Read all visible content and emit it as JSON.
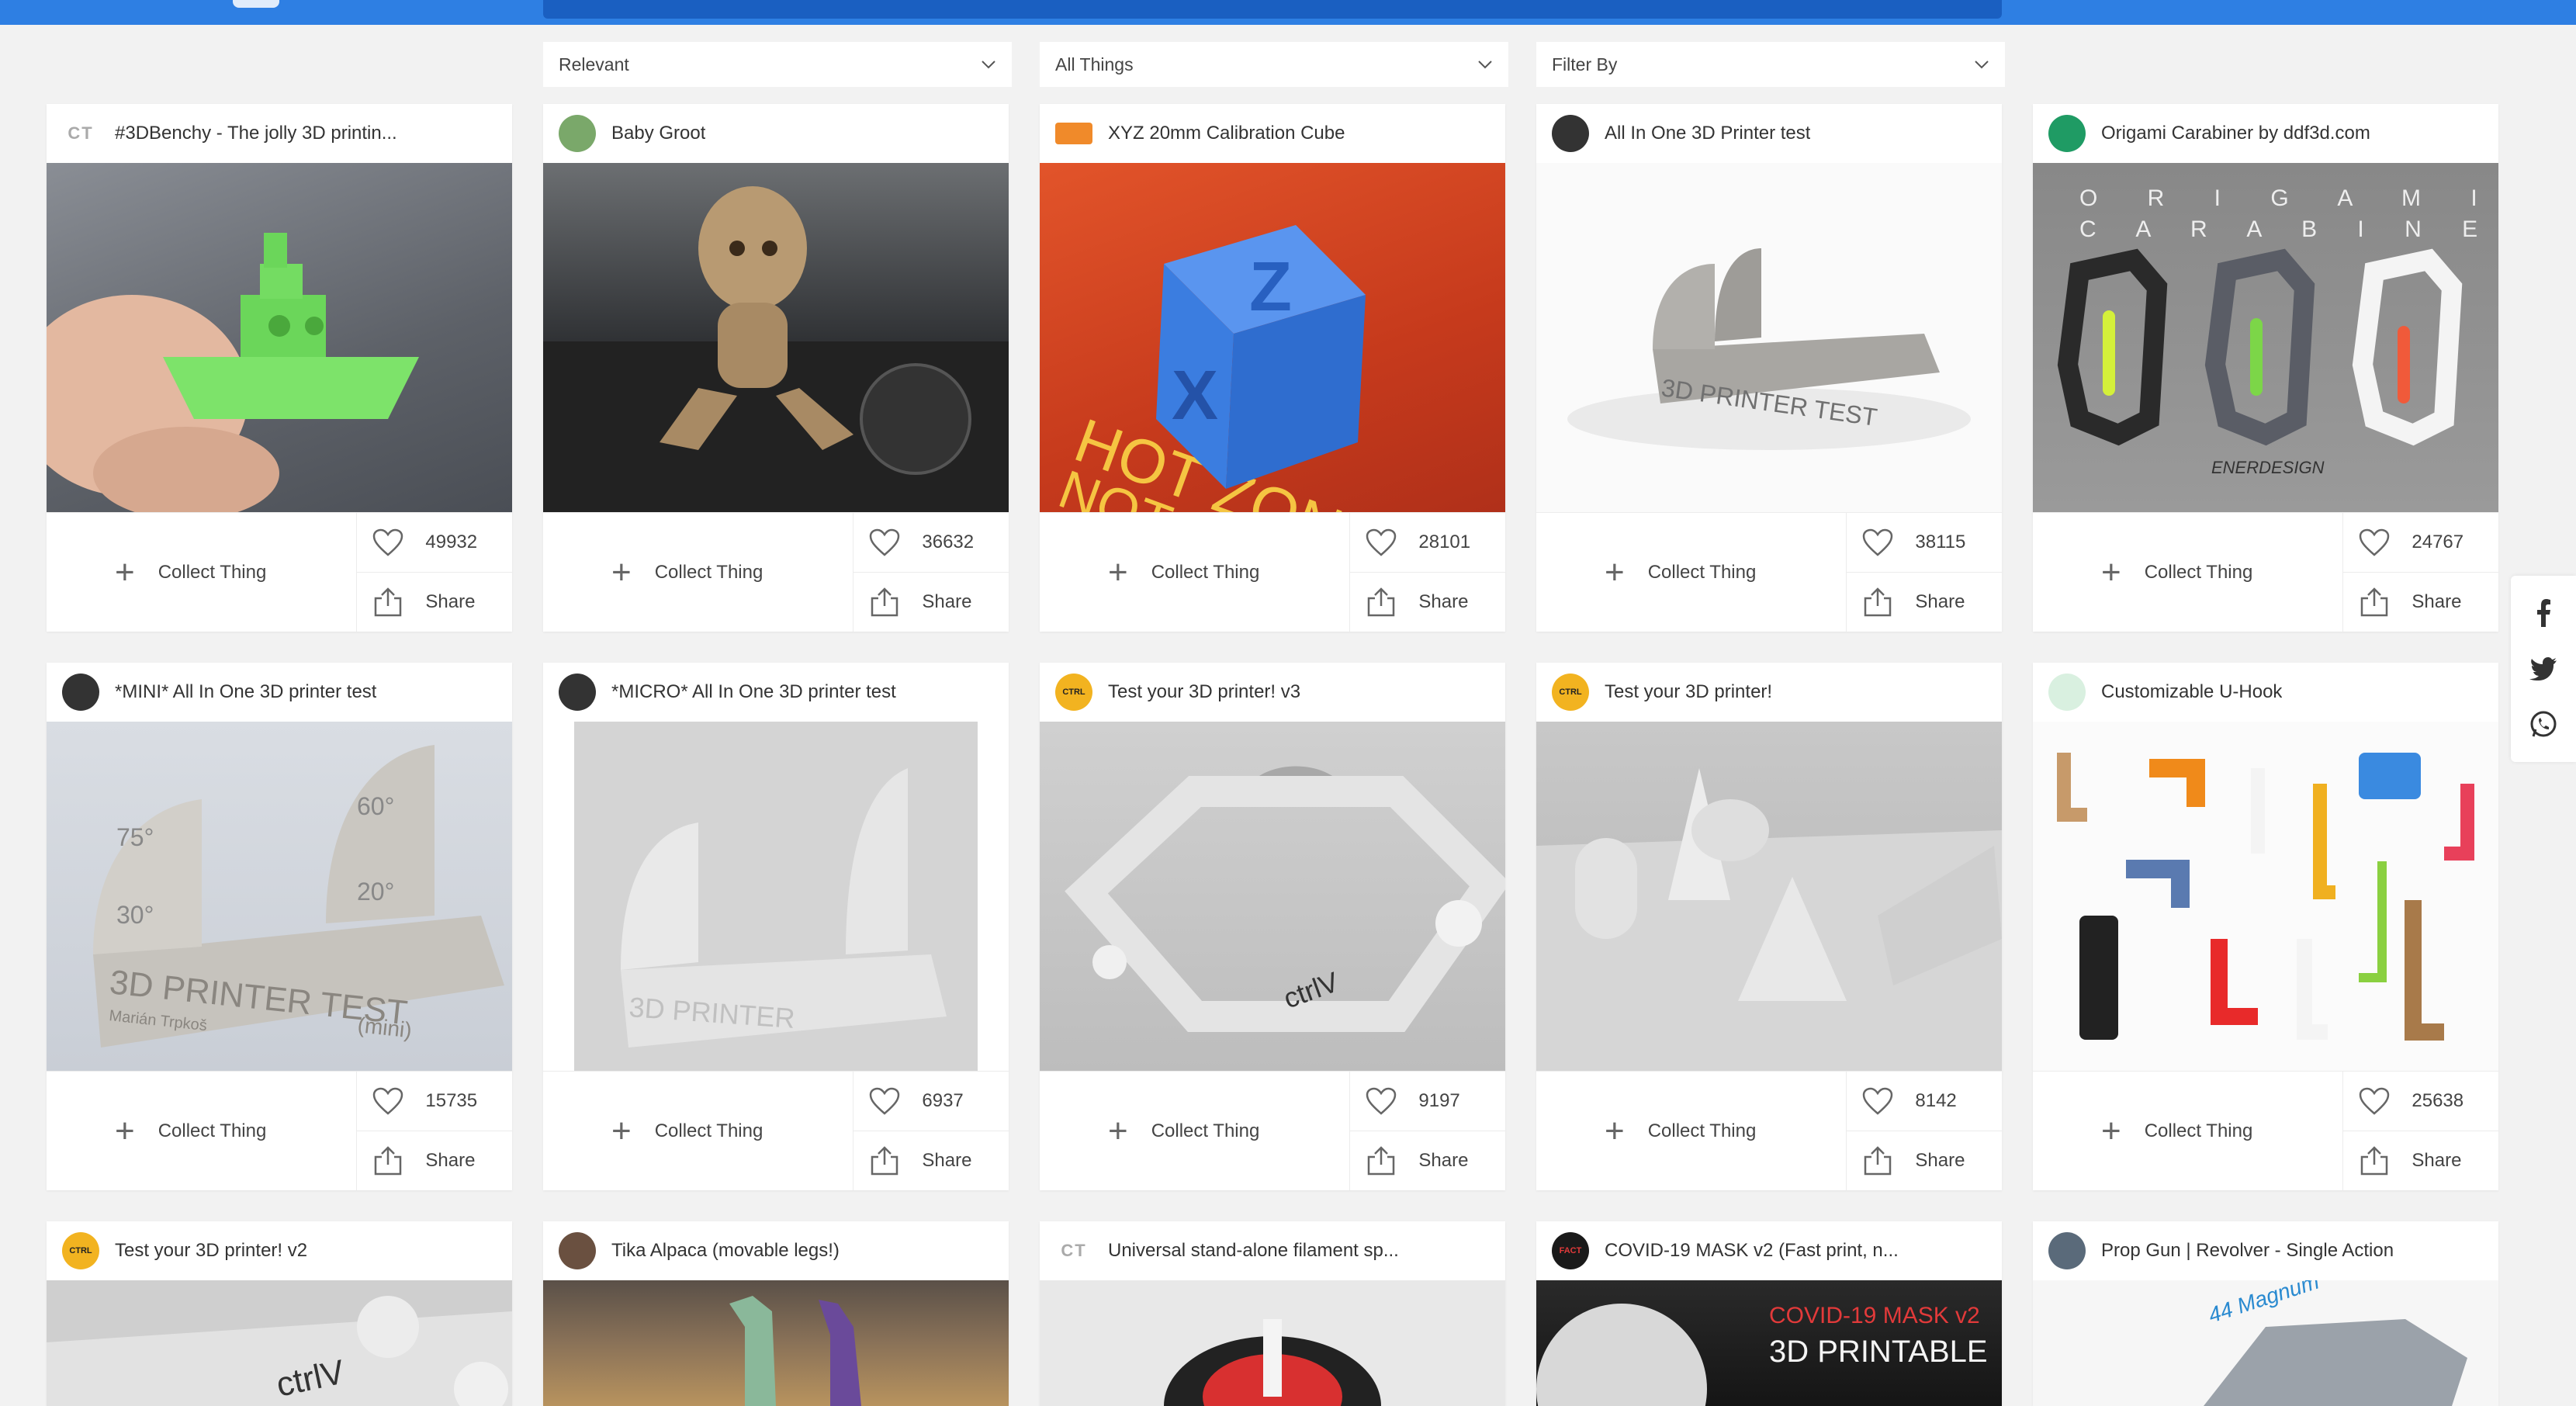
{
  "filters": [
    {
      "label": "Relevant"
    },
    {
      "label": "All Things"
    },
    {
      "label": "Filter By"
    }
  ],
  "cards": [
    {
      "title": "#3DBenchy - The jolly 3D printin...",
      "likes": "49932",
      "collect": "Collect Thing",
      "share": "Share",
      "avatar": "CT"
    },
    {
      "title": "Baby Groot",
      "likes": "36632",
      "collect": "Collect Thing",
      "share": "Share",
      "avatar": ""
    },
    {
      "title": "XYZ 20mm Calibration Cube",
      "likes": "28101",
      "collect": "Collect Thing",
      "share": "Share",
      "avatar": ""
    },
    {
      "title": "All In One 3D Printer test",
      "likes": "38115",
      "collect": "Collect Thing",
      "share": "Share",
      "avatar": ""
    },
    {
      "title": "Origami Carabiner by ddf3d.com",
      "likes": "24767",
      "collect": "Collect Thing",
      "share": "Share",
      "avatar": ""
    },
    {
      "title": "*MINI* All In One 3D printer test",
      "likes": "15735",
      "collect": "Collect Thing",
      "share": "Share",
      "avatar": ""
    },
    {
      "title": "*MICRO* All In One 3D printer test",
      "likes": "6937",
      "collect": "Collect Thing",
      "share": "Share",
      "avatar": ""
    },
    {
      "title": "Test your 3D printer! v3",
      "likes": "9197",
      "collect": "Collect Thing",
      "share": "Share",
      "avatar": "CTRL"
    },
    {
      "title": "Test your 3D printer!",
      "likes": "8142",
      "collect": "Collect Thing",
      "share": "Share",
      "avatar": "CTRL"
    },
    {
      "title": "Customizable U-Hook",
      "likes": "25638",
      "collect": "Collect Thing",
      "share": "Share",
      "avatar": ""
    },
    {
      "title": "Test your 3D printer! v2",
      "likes": "",
      "collect": "",
      "share": "",
      "avatar": "CTRL"
    },
    {
      "title": "Tika Alpaca (movable legs!)",
      "likes": "",
      "collect": "",
      "share": "",
      "avatar": ""
    },
    {
      "title": "Universal stand-alone filament sp...",
      "likes": "",
      "collect": "",
      "share": "",
      "avatar": "CT"
    },
    {
      "title": "COVID-19 MASK v2 (Fast print, n...",
      "likes": "",
      "collect": "",
      "share": "",
      "avatar": "FACT"
    },
    {
      "title": "Prop Gun | Revolver - Single Action",
      "likes": "",
      "collect": "",
      "share": "",
      "avatar": ""
    }
  ],
  "thumb_text": {
    "carabiner_line1": "O R I G A M I",
    "carabiner_line2": "C A R A B I N E R",
    "carabiner_brand": "ENERDESIGN",
    "cube_zone": "HOT ZONE",
    "cube_not": "NOT",
    "mini_test": "3D PRINTER TEST",
    "mini_sub": "(mini)",
    "mini_author": "Marián Trpkoš",
    "allinone_test": "3D PRINTER TEST",
    "micro_test": "3D PRINTER",
    "v3_brand": "ctrlV",
    "v2_brand": "ctrlV",
    "covid_line1": "COVID-19 MASK v2",
    "covid_line2": "3D PRINTABLE",
    "revolver_tag": "44 Magnum"
  },
  "social": [
    {
      "name": "facebook"
    },
    {
      "name": "twitter"
    },
    {
      "name": "whatsapp"
    }
  ],
  "colors": {
    "brand_blue": "#2e7fe3",
    "benchy_green": "#7de36a",
    "cube_blue": "#3b7de0",
    "covid_red": "#e23a3a"
  }
}
